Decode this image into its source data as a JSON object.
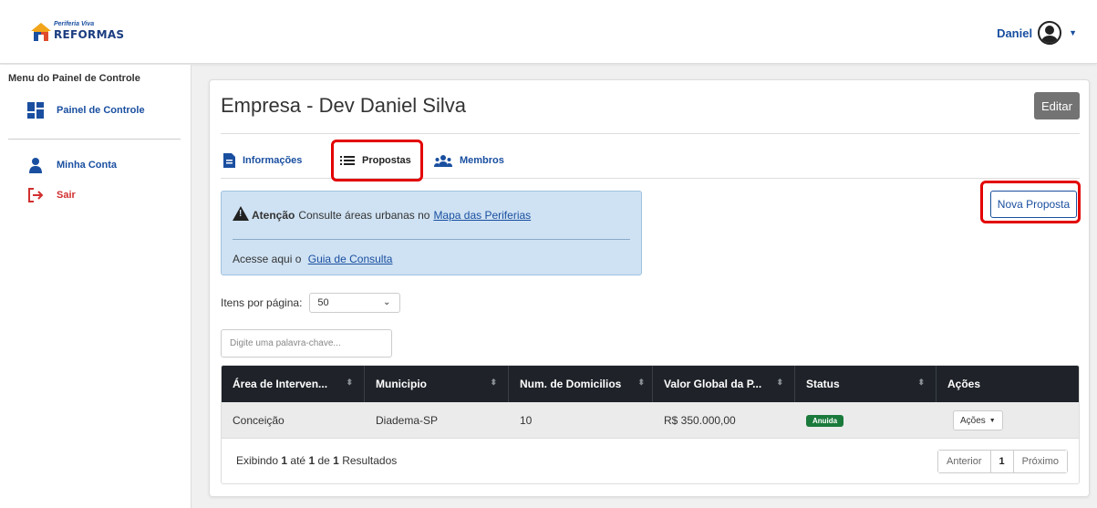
{
  "header": {
    "logo_top": "Periferia Viva",
    "logo_bottom": "REFORMAS",
    "user_name": "Daniel"
  },
  "sidebar": {
    "title": "Menu do Painel de Controle",
    "items": [
      {
        "label": "Painel de Controle",
        "icon": "dashboard-icon"
      },
      {
        "label": "Minha Conta",
        "icon": "user-icon"
      },
      {
        "label": "Sair",
        "icon": "logout-icon"
      }
    ]
  },
  "main": {
    "title": "Empresa - Dev Daniel Silva",
    "edit_label": "Editar",
    "tabs": [
      {
        "label": "Informações",
        "icon": "document-icon"
      },
      {
        "label": "Propostas",
        "icon": "list-icon"
      },
      {
        "label": "Membros",
        "icon": "users-icon"
      }
    ],
    "alert": {
      "strong": "Atenção",
      "text": "Consulte áreas urbanas no",
      "link1": "Mapa das Periferias",
      "text2": "Acesse aqui o",
      "link2": "Guia de Consulta"
    },
    "nova_proposta_label": "Nova Proposta",
    "per_page_label": "Itens por página:",
    "per_page_value": "50",
    "search_placeholder": "Digite uma palavra-chave...",
    "table": {
      "headers": [
        "Área de Interven...",
        "Municipio",
        "Num. de Domicilios",
        "Valor Global da P...",
        "Status",
        "Ações"
      ],
      "rows": [
        {
          "area": "Conceição",
          "municipio": "Diadema-SP",
          "domicilios": "10",
          "valor": "R$ 350.000,00",
          "status": "Anuida",
          "acoes": "Ações"
        }
      ]
    },
    "footer": {
      "exibindo": "Exibindo",
      "from": "1",
      "ate": "até",
      "to": "1",
      "de": "de",
      "total": "1",
      "resultados": "Resultados",
      "prev": "Anterior",
      "page": "1",
      "next": "Próximo"
    }
  },
  "colors": {
    "accent": "#1a4fa0",
    "highlight": "#e30000",
    "status_green": "#1a7a3c",
    "table_header": "#1f2329"
  }
}
